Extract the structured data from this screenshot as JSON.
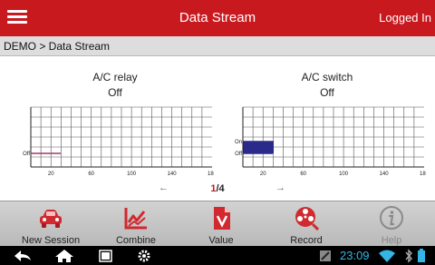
{
  "header": {
    "title": "Data Stream",
    "status": "Logged In"
  },
  "breadcrumb": "DEMO > Data Stream",
  "charts": [
    {
      "title": "A/C relay",
      "value": "Off",
      "x_ticks": [
        "20",
        "60",
        "100",
        "140",
        "180"
      ],
      "y_labels": [
        "Off"
      ]
    },
    {
      "title": "A/C switch",
      "value": "Off",
      "x_ticks": [
        "20",
        "60",
        "100",
        "140",
        "180"
      ],
      "y_labels": [
        "On",
        "Off"
      ]
    }
  ],
  "chart_data": [
    {
      "type": "line",
      "title": "A/C relay",
      "xlim": [
        0,
        180
      ],
      "x_ticks": [
        20,
        60,
        100,
        140,
        180
      ],
      "y_states": [
        "Off"
      ],
      "series": [
        {
          "color": "#9c3a6a",
          "x": [
            0,
            30
          ],
          "y": [
            "Off",
            "Off"
          ]
        }
      ]
    },
    {
      "type": "line",
      "title": "A/C switch",
      "xlim": [
        0,
        180
      ],
      "x_ticks": [
        20,
        60,
        100,
        140,
        180
      ],
      "y_states": [
        "Off",
        "On"
      ],
      "series": [
        {
          "color": "#2a2a8a",
          "x": [
            0,
            1,
            2,
            3,
            4,
            5,
            6,
            7,
            8,
            9,
            10,
            11,
            12,
            13,
            14,
            15,
            16,
            17,
            18,
            19,
            20,
            21,
            22,
            23,
            24,
            25,
            26,
            27,
            28,
            29,
            30
          ],
          "y": [
            "Off",
            "On",
            "Off",
            "On",
            "Off",
            "On",
            "Off",
            "On",
            "Off",
            "On",
            "Off",
            "On",
            "Off",
            "On",
            "Off",
            "On",
            "Off",
            "On",
            "Off",
            "On",
            "Off",
            "On",
            "Off",
            "On",
            "Off",
            "On",
            "Off",
            "On",
            "Off",
            "On",
            "Off"
          ]
        }
      ]
    }
  ],
  "pager": {
    "prev": "←",
    "current": "1",
    "separator": "/",
    "total": "4",
    "next": "→"
  },
  "toolbar": [
    {
      "label": "New Session",
      "icon": "car-icon"
    },
    {
      "label": "Combine",
      "icon": "chart-icon"
    },
    {
      "label": "Value",
      "icon": "document-icon"
    },
    {
      "label": "Record",
      "icon": "film-reel-icon"
    },
    {
      "label": "Help",
      "icon": "info-icon"
    }
  ],
  "system": {
    "time": "23:09",
    "icons": [
      "back-icon",
      "home-icon",
      "recent-apps-icon",
      "settings-icon",
      "notification-icon",
      "wifi-icon",
      "battery-icon"
    ]
  },
  "colors": {
    "accent": "#c8191f",
    "toolbar_icon": "#d0292f",
    "system_text": "#33b5e5"
  }
}
